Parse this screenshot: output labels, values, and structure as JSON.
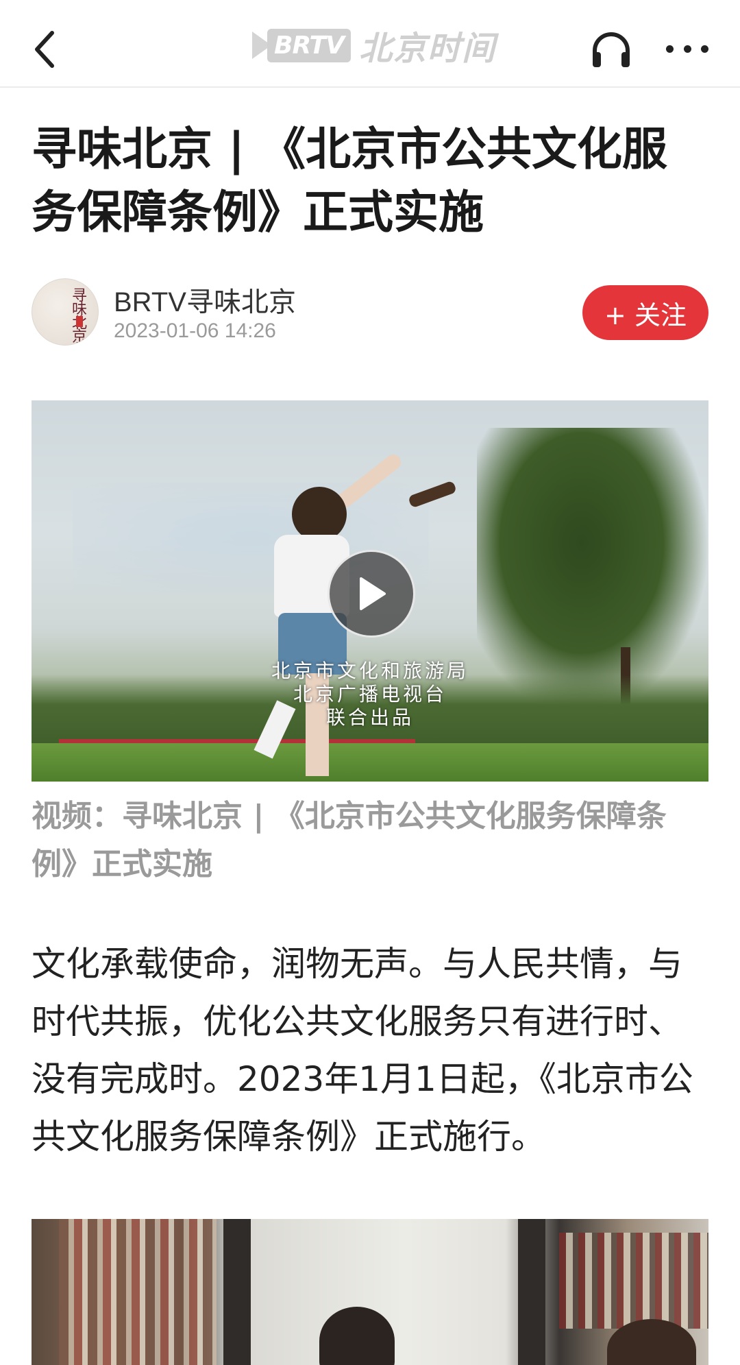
{
  "header": {
    "brand_badge": "BRTV",
    "brand_name": "北京时间",
    "back_icon": "chevron-left-icon",
    "listen_icon": "headphones-icon",
    "more_icon": "more-horizontal-icon"
  },
  "article": {
    "title": "寻味北京 | 《北京市公共文化服务保障条例》正式实施",
    "author": {
      "avatar_text": "寻味北京",
      "name": "BRTV寻味北京",
      "time": "2023-01-06 14:26",
      "follow_label": "+ 关注"
    },
    "video": {
      "overlay_lines": [
        "北京市文化和旅游局",
        "北京广播电视台",
        "联合出品"
      ],
      "play_icon": "play-icon",
      "caption": "视频：寻味北京 | 《北京市公共文化服务保障条例》正式实施"
    },
    "paragraph": "文化承载使命，润物无声。与人民共情，与时代共振，优化公共文化服务只有进行时、没有完成时。2023年1月1日起，《北京市公共文化服务保障条例》正式施行。"
  },
  "colors": {
    "accent": "#e3353a",
    "muted_text": "#9a9a9a",
    "brand_gray": "#d0d0d0"
  }
}
